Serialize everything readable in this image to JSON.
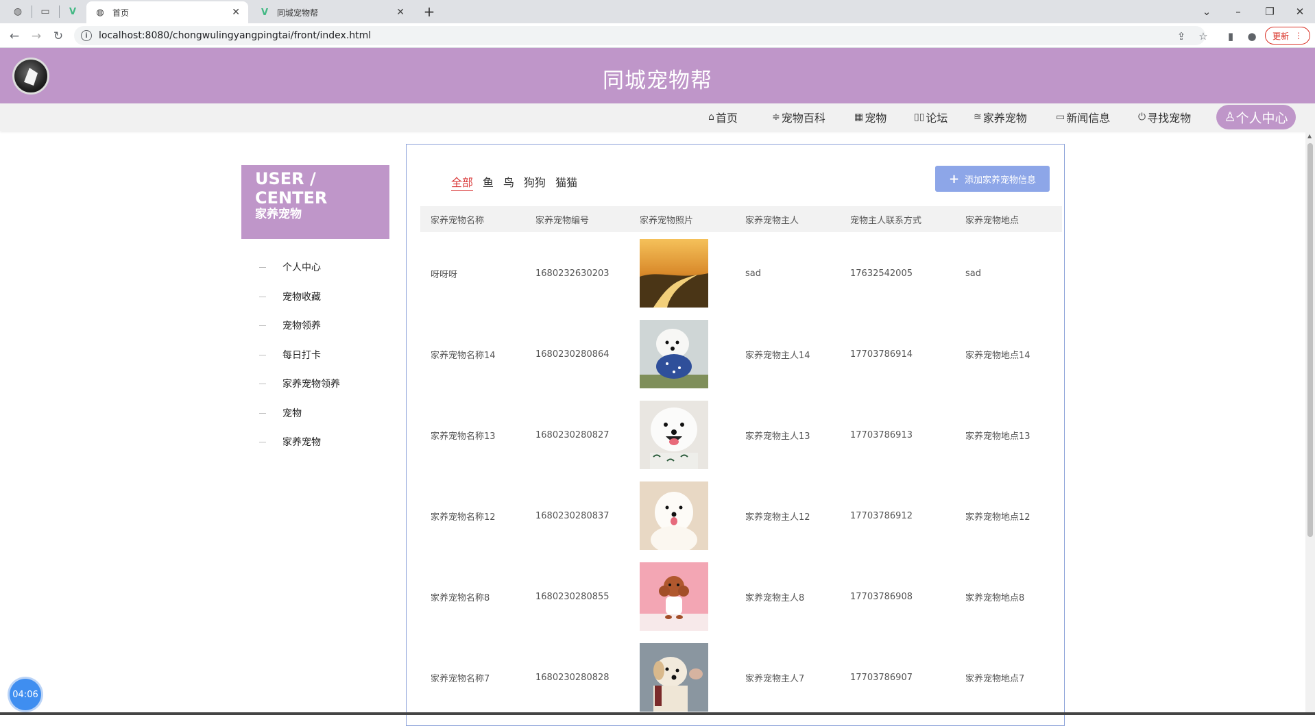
{
  "browser": {
    "tabs": [
      {
        "title": "首页",
        "active": true
      },
      {
        "title": "同城宠物帮",
        "active": false
      }
    ],
    "url": "localhost:8080/chongwulingyangpingtai/front/index.html",
    "update_label": "更新"
  },
  "site": {
    "title": "同城宠物帮",
    "nav": [
      {
        "icon": "⌂",
        "label": "首页"
      },
      {
        "icon": "≑",
        "label": "宠物百科"
      },
      {
        "icon": "▦",
        "label": "宠物"
      },
      {
        "icon": "▯▯",
        "label": "论坛"
      },
      {
        "icon": "≋",
        "label": "家养宠物"
      },
      {
        "icon": "▭",
        "label": "新闻信息"
      },
      {
        "icon": "⏻",
        "label": "寻找宠物"
      }
    ],
    "nav_active": {
      "icon": "♙",
      "label": "个人中心"
    }
  },
  "sidebar": {
    "title": "USER / CENTER",
    "subtitle": "家养宠物",
    "items": [
      "个人中心",
      "宠物收藏",
      "宠物领养",
      "每日打卡",
      "家养宠物领养",
      "宠物",
      "家养宠物"
    ]
  },
  "filters": {
    "items": [
      "全部",
      "鱼",
      "鸟",
      "狗狗",
      "猫猫"
    ],
    "active_index": 0
  },
  "add_button": {
    "label": "添加家养宠物信息"
  },
  "table": {
    "headers": [
      "家养宠物名称",
      "家养宠物编号",
      "家养宠物照片",
      "家养宠物主人",
      "宠物主人联系方式",
      "家养宠物地点"
    ],
    "rows": [
      {
        "name": "呀呀呀",
        "code": "1680232630203",
        "photo": "sunset-landscape",
        "owner": "sad",
        "phone": "17632542005",
        "place": "sad"
      },
      {
        "name": "家养宠物名称14",
        "code": "1680230280864",
        "photo": "white-dog-blue-shirt",
        "owner": "家养宠物主人14",
        "phone": "17703786914",
        "place": "家养宠物地点14"
      },
      {
        "name": "家养宠物名称13",
        "code": "1680230280827",
        "photo": "samoyed-smiling",
        "owner": "家养宠物主人13",
        "phone": "17703786913",
        "place": "家养宠物地点13"
      },
      {
        "name": "家养宠物名称12",
        "code": "1680230280837",
        "photo": "samoyed-puppy",
        "owner": "家养宠物主人12",
        "phone": "17703786912",
        "place": "家养宠物地点12"
      },
      {
        "name": "家养宠物名称8",
        "code": "1680230280855",
        "photo": "poodle-pink",
        "owner": "家养宠物主人8",
        "phone": "17703786908",
        "place": "家养宠物地点8"
      },
      {
        "name": "家养宠物名称7",
        "code": "1680230280828",
        "photo": "retriever-puppy",
        "owner": "家养宠物主人7",
        "phone": "17703786907",
        "place": "家养宠物地点7"
      }
    ]
  },
  "timer": "04:06",
  "colors": {
    "brand": "#bf96c9",
    "accent_button": "#8da6e8",
    "filter_active": "#d93838",
    "card_border": "#8aa0d8"
  }
}
